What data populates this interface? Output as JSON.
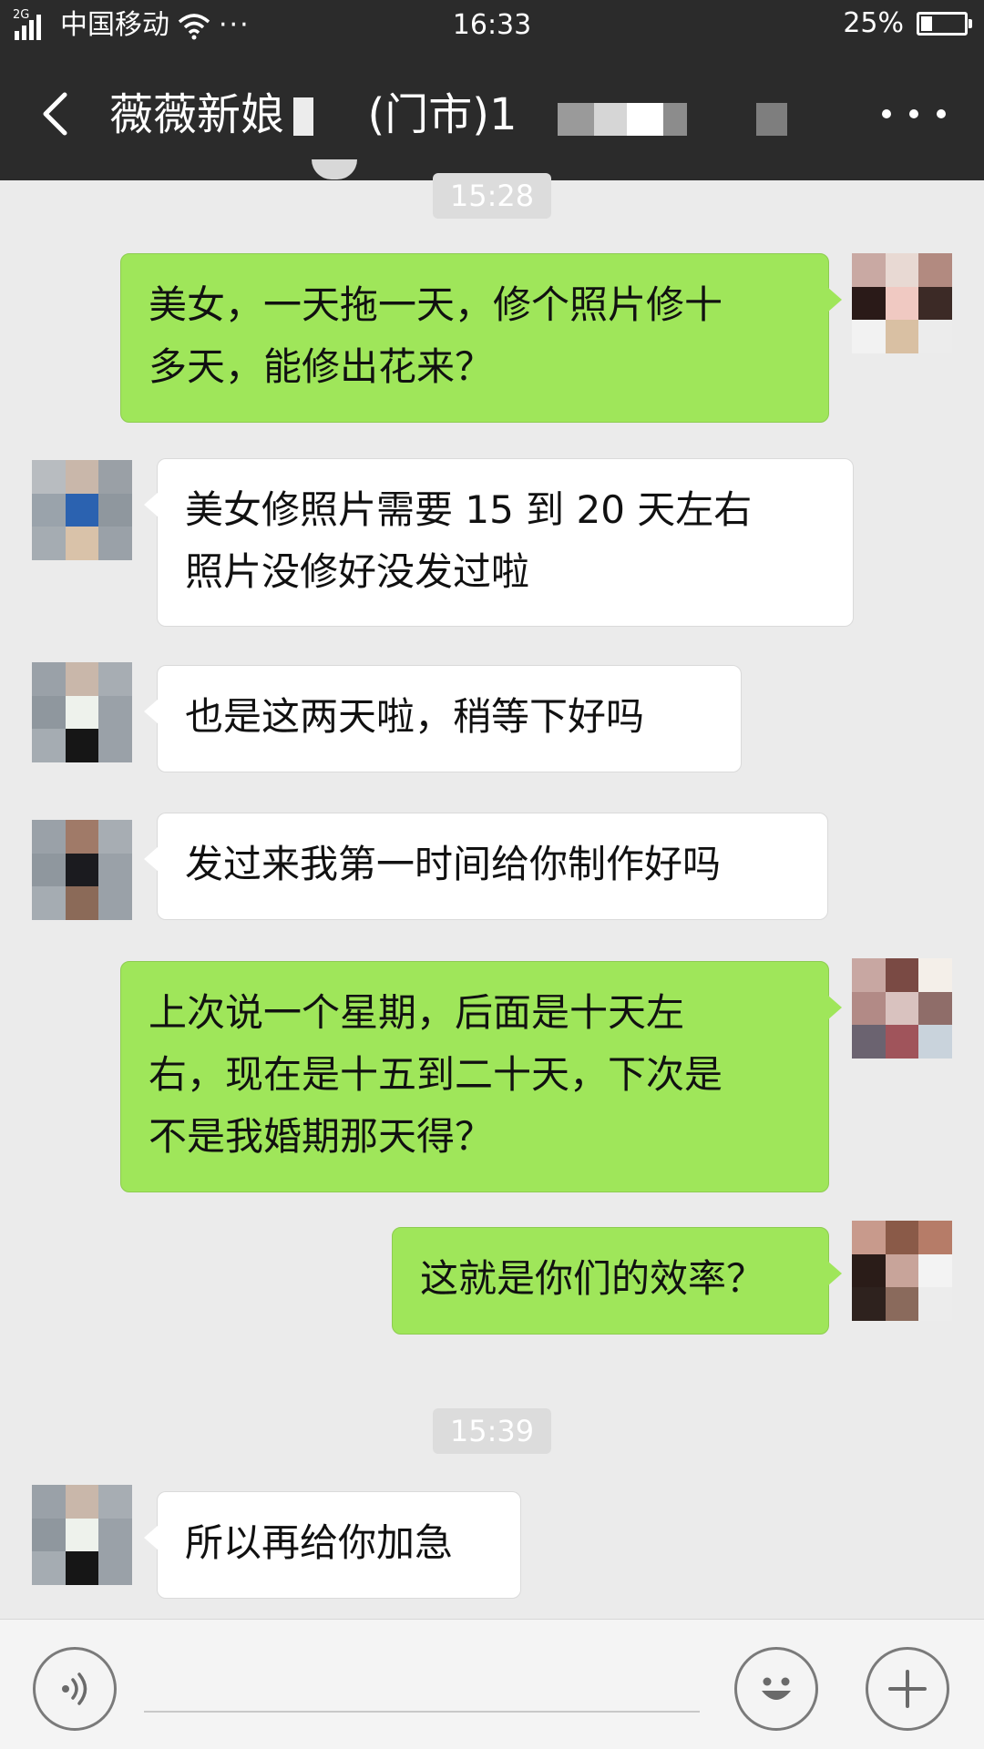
{
  "status_bar": {
    "network_type": "2G",
    "carrier": "中国移动",
    "more": "···",
    "time": "16:33",
    "battery": "25%",
    "battery_level": 0.25,
    "icons": [
      "signal-icon",
      "wifi-icon",
      "battery-icon"
    ]
  },
  "title_bar": {
    "back_icon": "back-arrow-icon",
    "title": "薇薇新娘      (门市)1",
    "more_icon": "more-dots-icon"
  },
  "messages": [
    {
      "type": "time",
      "text": "15:28"
    },
    {
      "type": "sent",
      "text": "美女，一天拖一天，修个照片修十\n多天，能修出花来？"
    },
    {
      "type": "received",
      "text": "美女修照片需要 15 到 20 天左右\n照片没修好没发过啦"
    },
    {
      "type": "received",
      "text": "也是这两天啦，稍等下好吗"
    },
    {
      "type": "received",
      "text": "发过来我第一时间给你制作好吗"
    },
    {
      "type": "sent",
      "text": "上次说一个星期，后面是十天左\n右，现在是十五到二十天，下次是\n不是我婚期那天得？"
    },
    {
      "type": "sent",
      "text": "这就是你们的效率？"
    },
    {
      "type": "time",
      "text": "15:39"
    },
    {
      "type": "received",
      "text": "所以再给你加急"
    }
  ],
  "input_bar": {
    "voice_icon": "voice-icon",
    "emoji_icon": "emoji-icon",
    "plus_icon": "plus-icon"
  },
  "colors": {
    "sent_bubble": "#9fe65a",
    "received_bubble": "#ffffff",
    "chat_background": "#ebebeb",
    "header_background": "#2b2b2b"
  }
}
